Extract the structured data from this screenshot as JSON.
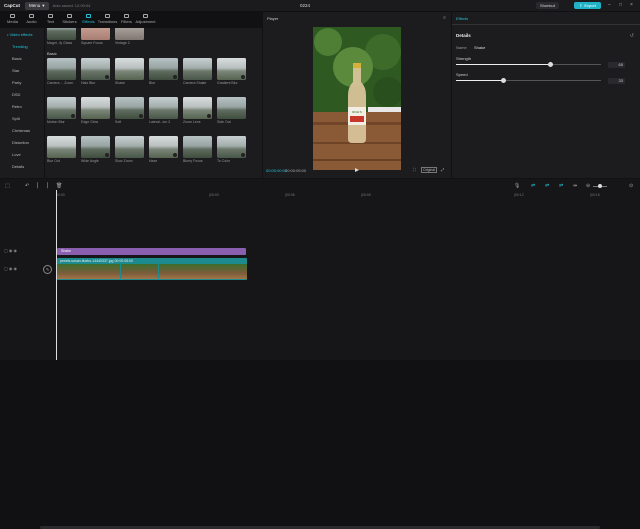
{
  "titlebar": {
    "app_name": "CapCut",
    "menu_label": "Menu",
    "autosave": "Auto saved: 12:09:04",
    "project_title": "0224",
    "shortcut_label": "Shortcut",
    "export_label": "Export"
  },
  "toolbar": {
    "tabs": [
      {
        "label": "Media",
        "icon": "media-icon"
      },
      {
        "label": "Audio",
        "icon": "audio-icon"
      },
      {
        "label": "Text",
        "icon": "text-icon"
      },
      {
        "label": "Stickers",
        "icon": "stickers-icon"
      },
      {
        "label": "Effects",
        "icon": "effects-icon",
        "active": true
      },
      {
        "label": "Transitions",
        "icon": "transitions-icon"
      },
      {
        "label": "Filters",
        "icon": "filters-icon"
      },
      {
        "label": "Adjustment",
        "icon": "adjustment-icon"
      }
    ]
  },
  "sidebar": {
    "header": "• Video effects",
    "items": [
      "Trending",
      "Basic",
      "Star",
      "Party",
      "DSD",
      "Retro",
      "Split",
      "Christmas",
      "Distortion",
      "Love",
      "Details"
    ],
    "selected": "Trending"
  },
  "effects_grid": {
    "top_row": [
      "Magni...fy Glass",
      "Square Focus",
      "Vintage 2"
    ],
    "section_label": "Basic",
    "rows": [
      [
        "Camera ... Zoom",
        "Halo Blur",
        "Shake",
        "Blur",
        "Camera Shake",
        "Gradient Blur"
      ],
      [
        "Motion Blur",
        "Edge Glow",
        "Soft",
        "Lateral...ion 2",
        "Zoom Lens",
        "Side Out"
      ],
      [
        "Blur Out",
        "Wide Angle",
        "Slow Zoom",
        "Haze",
        "Blurry Focus",
        "To Color"
      ]
    ]
  },
  "player": {
    "title": "Player",
    "current_time": "00:00:00:00",
    "total_time": "00:00:05:00",
    "ratio_label": "Original",
    "bottle_label": "RICE'S"
  },
  "effects_panel": {
    "tab_label": "Effects",
    "details_label": "Details",
    "name_key": "Name",
    "name_value": "Shake",
    "strength_label": "Strength",
    "strength_value": "65",
    "speed_label": "Speed",
    "speed_value": "33",
    "strength_fraction": 0.65,
    "speed_fraction": 0.33
  },
  "timeline": {
    "ruler_ticks": [
      "00:00",
      "|00:03",
      "|00:06",
      "|00:09",
      "|00:12",
      "|00:15"
    ],
    "effect_clip_label": "Shake",
    "video_clip_label": "pexels-susan-ifueko-14440337.jpg  00:00:05:00"
  },
  "colors": {
    "accent": "#20c6d8",
    "export": "#20b3c8",
    "effect_clip": "#8a5fb0",
    "video_clip": "#1c8a8f"
  }
}
